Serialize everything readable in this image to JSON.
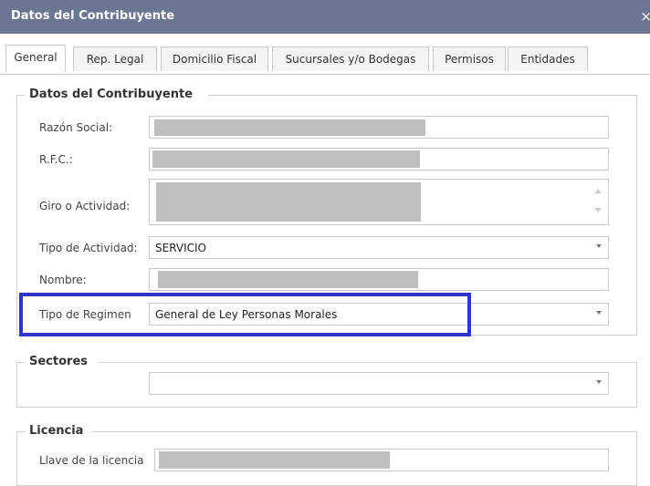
{
  "window": {
    "title": "Datos del Contribuyente",
    "close_glyph": "×"
  },
  "tabs": [
    {
      "label": "General",
      "active": true
    },
    {
      "label": "Rep. Legal",
      "active": false
    },
    {
      "label": "Domicilio Fiscal",
      "active": false
    },
    {
      "label": "Sucursales y/o Bodegas",
      "active": false
    },
    {
      "label": "Permisos",
      "active": false
    },
    {
      "label": "Entidades",
      "active": false
    }
  ],
  "group_contribuyente": {
    "legend": "Datos del Contribuyente",
    "razon_social_label": "Razón Social:",
    "rfc_label": "R.F.C.:",
    "giro_label": "Giro o Actividad:",
    "tipo_actividad_label": "Tipo de Actividad:",
    "tipo_actividad_value": "SERVICIO",
    "nombre_label": "Nombre:",
    "tipo_regimen_label": "Tipo de Regimen",
    "tipo_regimen_value": "General de Ley Personas Morales"
  },
  "group_sectores": {
    "legend": "Sectores",
    "value": ""
  },
  "group_licencia": {
    "legend": "Licencia",
    "llave_label": "Llave de la licencia"
  },
  "colors": {
    "titlebar": "#6b7693",
    "highlight": "#2d36c6",
    "redaction": "#bfbfbf"
  }
}
